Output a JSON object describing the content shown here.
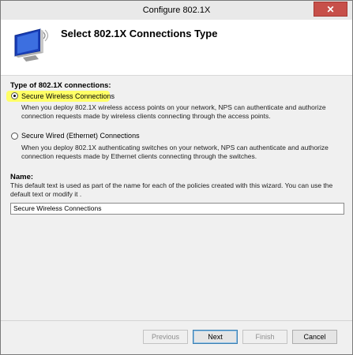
{
  "window": {
    "title": "Configure 802.1X",
    "close_glyph": "✕"
  },
  "header": {
    "title": "Select 802.1X Connections Type",
    "icon": "wireless-monitor-icon"
  },
  "connection_type": {
    "label": "Type of 802.1X connections:",
    "options": [
      {
        "label": "Secure Wireless Connections",
        "selected": true,
        "description": "When you deploy 802.1X wireless access points on your network, NPS can authenticate and authorize connection requests made by wireless clients connecting through the access points."
      },
      {
        "label": "Secure Wired (Ethernet) Connections",
        "selected": false,
        "description": "When you deploy 802.1X authenticating switches on your network, NPS can authenticate and authorize connection requests made by Ethernet clients connecting through the switches."
      }
    ]
  },
  "name": {
    "label": "Name:",
    "description": "This default text is used as part of the name for each of the policies created with this wizard. You can use the default text or modify it .",
    "value": "Secure Wireless Connections"
  },
  "buttons": {
    "previous": "Previous",
    "next": "Next",
    "finish": "Finish",
    "cancel": "Cancel"
  },
  "colors": {
    "highlight": "#ffff66",
    "close_button": "#c7504a"
  }
}
